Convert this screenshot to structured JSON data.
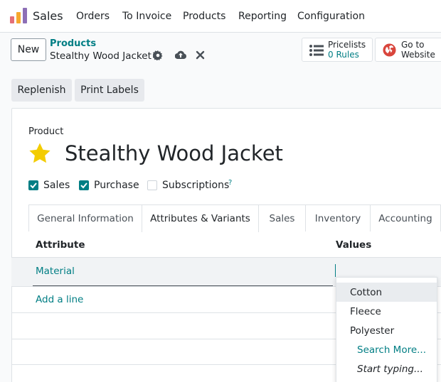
{
  "navbar": {
    "app_name": "Sales",
    "menu": [
      "Orders",
      "To Invoice",
      "Products",
      "Reporting",
      "Configuration"
    ]
  },
  "control_panel": {
    "new_label": "New",
    "breadcrumb_parent": "Products",
    "breadcrumb_current": "Stealthy Wood Jacket",
    "pricelists": {
      "label": "Pricelists",
      "value": "0 Rules"
    },
    "website": {
      "line1": "Go to",
      "line2": "Website"
    }
  },
  "actions": {
    "replenish": "Replenish",
    "print_labels": "Print Labels"
  },
  "form": {
    "product_label": "Product",
    "product_name": "Stealthy Wood Jacket",
    "favorite": true,
    "checkboxes": [
      {
        "label": "Sales",
        "checked": true
      },
      {
        "label": "Purchase",
        "checked": true
      },
      {
        "label": "Subscriptions",
        "checked": false
      }
    ],
    "help_mark": "?"
  },
  "tabs": [
    {
      "label": "General Information",
      "active": false
    },
    {
      "label": "Attributes & Variants",
      "active": true
    },
    {
      "label": "Sales",
      "active": false
    },
    {
      "label": "Inventory",
      "active": false
    },
    {
      "label": "Accounting",
      "active": false
    }
  ],
  "table": {
    "headers": {
      "attribute": "Attribute",
      "values": "Values"
    },
    "rows": [
      {
        "attribute": "Material",
        "values": ""
      }
    ],
    "add_line": "Add a line"
  },
  "dropdown": {
    "options": [
      "Cotton",
      "Fleece",
      "Polyester"
    ],
    "search_more": "Search More...",
    "start_typing": "Start typing..."
  },
  "colors": {
    "accent": "#017e84",
    "star": "#f3cc00"
  }
}
